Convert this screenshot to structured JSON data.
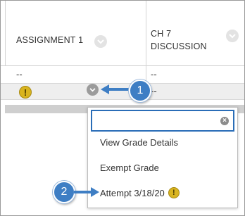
{
  "columns": [
    {
      "label_line1": "ASSIGNMENT 1",
      "label_line2": ""
    },
    {
      "label_line1": "CH 7",
      "label_line2": "DISCUSSION"
    }
  ],
  "rows": [
    {
      "assignment1": "--",
      "ch7": "--"
    },
    {
      "assignment1_icon": "warning-icon",
      "ch7": "--"
    }
  ],
  "callouts": {
    "one": "1",
    "two": "2"
  },
  "menu": {
    "search_value": "",
    "items": [
      "View Grade Details",
      "Exempt Grade",
      "Attempt 3/18/20"
    ],
    "attempt_icon": "warning-icon"
  },
  "colors": {
    "accent": "#3e7ec4",
    "focus": "#2a6db7",
    "warning": "#d9b41f"
  }
}
